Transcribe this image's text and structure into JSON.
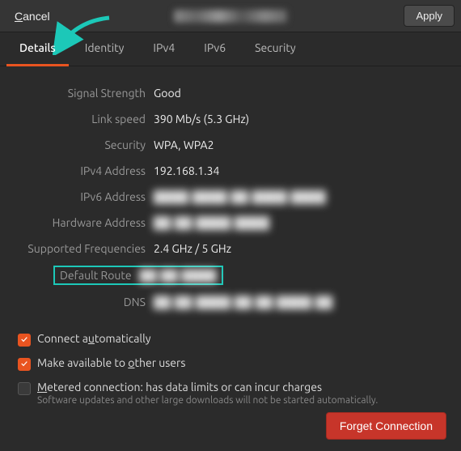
{
  "header": {
    "cancel_mnemonic": "C",
    "cancel_rest": "ancel",
    "apply_label": "Apply",
    "title": "████████ ████"
  },
  "tabs": [
    {
      "label": "Details",
      "active": true
    },
    {
      "label": "Identity",
      "active": false
    },
    {
      "label": "IPv4",
      "active": false
    },
    {
      "label": "IPv6",
      "active": false
    },
    {
      "label": "Security",
      "active": false
    }
  ],
  "details": {
    "signal_strength": {
      "label": "Signal Strength",
      "value": "Good"
    },
    "link_speed": {
      "label": "Link speed",
      "value": "390 Mb/s (5.3 GHz)"
    },
    "security": {
      "label": "Security",
      "value": "WPA, WPA2"
    },
    "ipv4": {
      "label": "IPv4 Address",
      "value": "192.168.1.34"
    },
    "ipv6": {
      "label": "IPv6 Address",
      "value": "████ ████ ██ ████ ████"
    },
    "hw": {
      "label": "Hardware Address",
      "value": "██ ██ ████ ████"
    },
    "freq": {
      "label": "Supported Frequencies",
      "value": "2.4 GHz / 5 GHz"
    },
    "route": {
      "label": "Default Route",
      "value": "██ ██ ████"
    },
    "dns": {
      "label": "DNS",
      "value": "██ ██ ████ ██ ██ ████ ██"
    }
  },
  "checks": {
    "auto_pre": "Connect a",
    "auto_m": "u",
    "auto_post": "tomatically",
    "avail_pre": "Make available to ",
    "avail_m": "o",
    "avail_post": "ther users",
    "metered_m": "M",
    "metered_post": "etered connection: has data limits or can incur charges",
    "metered_sub": "Software updates and other large downloads will not be started automatically."
  },
  "footer": {
    "forget_label": "Forget Connection"
  },
  "colors": {
    "accent": "#e95420",
    "highlight": "#1cc8b8",
    "danger": "#c7352a"
  }
}
